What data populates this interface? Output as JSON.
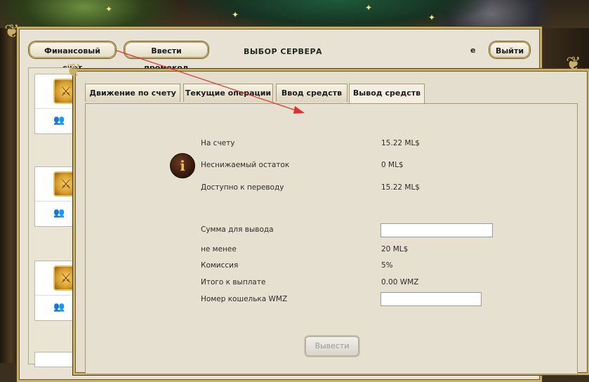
{
  "header": {
    "finance_button": "Финансовый счет",
    "promo_button": "Ввести промокод",
    "server_title": "ВЫБОР СЕРВЕРА",
    "e_label": "e",
    "logout_button": "Выйти"
  },
  "tabs": [
    {
      "label": "Движение по счету",
      "active": false
    },
    {
      "label": "Текущие операции",
      "active": false
    },
    {
      "label": "Ввод средств",
      "active": false
    },
    {
      "label": "Вывод средств",
      "active": true
    }
  ],
  "withdraw": {
    "balance_label": "На счету",
    "balance_value": "15.22 ML$",
    "min_rest_label": "Неснижаемый остаток",
    "min_rest_value": "0 ML$",
    "available_label": "Доступно к переводу",
    "available_value": "15.22 ML$",
    "amount_label": "Сумма для вывода",
    "amount_value": "",
    "min_label": "не менее",
    "min_value": "20 ML$",
    "commission_label": "Комиссия",
    "commission_value": "5%",
    "total_label": "Итого к выплате",
    "total_value": "0.00 WMZ",
    "wallet_label": "Номер кошелька WMZ",
    "wallet_value": "",
    "submit_button": "Вывести"
  },
  "icons": {
    "info": "info-icon",
    "card": "sword-shield-icon",
    "people": "group-people-icon"
  },
  "colors": {
    "accent_gold": "#c9b06a",
    "arrow_red": "#e03030",
    "panel_bg": "#e6e0d1"
  }
}
